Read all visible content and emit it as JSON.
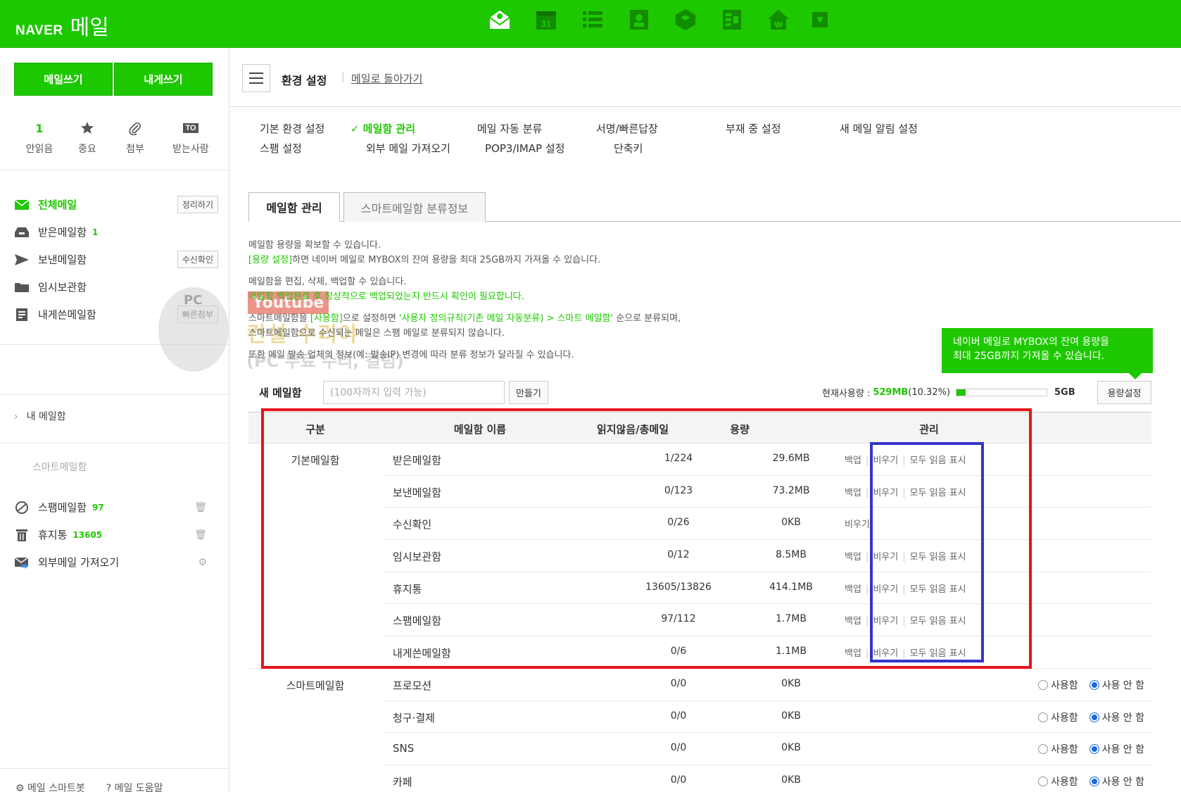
{
  "header": {
    "logo_naver": "NAVER",
    "logo_mail": "메일",
    "icons": [
      "mail-icon",
      "calendar-icon",
      "list-icon",
      "contacts-icon",
      "box-icon",
      "memo-icon",
      "home-icon",
      "more-icon"
    ],
    "calendar_day": "31",
    "brand_color": "#1ec800"
  },
  "sidebar": {
    "write_mail": "메일쓰기",
    "write_self": "내게쓰기",
    "quick": {
      "unread_count": "1",
      "unread_label": "안읽음",
      "important_label": "중요",
      "attach_label": "첨부",
      "to_badge": "TO",
      "recipient_label": "받는사람"
    },
    "folders": [
      {
        "label": "전체메일",
        "count": "",
        "button": "정리하기"
      },
      {
        "label": "받은메일함",
        "count": "1",
        "button": ""
      },
      {
        "label": "보낸메일함",
        "count": "",
        "button": "수신확인"
      },
      {
        "label": "임시보관함",
        "count": "",
        "button": ""
      },
      {
        "label": "내게쓴메일함",
        "count": "",
        "button": "빠른첨부"
      }
    ],
    "my_mailbox": "내 메일함",
    "smart_mailbox": "스마트메일함",
    "folders2": [
      {
        "label": "스팸메일함",
        "count": "97"
      },
      {
        "label": "휴지통",
        "count": "13605"
      },
      {
        "label": "외부메일 가져오기",
        "count": ""
      }
    ],
    "bottom_left": "메일 스마트봇",
    "bottom_right": "메일 도움말"
  },
  "watermark": {
    "badge": "PC",
    "youtube": "Youtube",
    "text": "컨설 수리야",
    "sub": "(PC 무료 수리, 컬럼)"
  },
  "main": {
    "title": "환경 설정",
    "separator": "|",
    "back_link": "메일로 돌아가기",
    "nav": [
      {
        "label": "기본 환경 설정",
        "active": false
      },
      {
        "label": "메일함 관리",
        "active": true
      },
      {
        "label": "메일 자동 분류",
        "active": false
      },
      {
        "label": "서명/빠른답장",
        "active": false
      },
      {
        "label": "부재 중 설정",
        "active": false
      },
      {
        "label": "새 메일 알림 설정",
        "active": false
      },
      {
        "label": "스팸 설정",
        "active": false
      },
      {
        "label": "외부 메일 가져오기",
        "active": false
      },
      {
        "label": "POP3/IMAP 설정",
        "active": false
      },
      {
        "label": "단축키",
        "active": false
      }
    ],
    "tabs": [
      "메일함 관리",
      "스마트메일함 분류정보"
    ],
    "desc": {
      "l1": "메일함 용량을 확보할 수 있습니다.",
      "l2_green": "[용량 설정]",
      "l2_rest": "하면 네이버 메일로 MYBOX의 잔여 용량을 최대 25GB까지 가져올 수 있습니다.",
      "l3": "메일함을 편집, 삭제, 백업할 수 있습니다.",
      "l4_green": "메일함 백업완료 후 정상적으로 백업되었는지 반드시 확인이 필요합니다.",
      "l5_a": "스마트메일함을 ",
      "l5_green1": "[사용함]",
      "l5_b": "으로 설정하면 ",
      "l5_green2": "'사용자 정의규칙(기존 메일 자동분류) > 스마트 메일함'",
      "l5_c": " 순으로 분류되며,",
      "l6": "스마트메일함으로 수신되는 메일은 스팸 메일로 분류되지 않습니다.",
      "l7": "또한 메일 발송 업체의 정보(예: 발송IP) 변경에 따라 분류 정보가 달라질 수 있습니다."
    },
    "tooltip_l1": "네이버 메일로 MYBOX의 잔여 용량을",
    "tooltip_l2": "최대 25GB까지 가져올 수 있습니다.",
    "new_box": {
      "label": "새 메일함",
      "placeholder": "(100자까지 입력 가능)",
      "button": "만들기"
    },
    "usage": {
      "label": "현재사용량 :",
      "value": "529MB",
      "percent_text": "(10.32%)",
      "percent": 10.32,
      "max": "5GB",
      "button": "용량설정"
    },
    "table": {
      "headers": [
        "구분",
        "메일함 이름",
        "읽지않음/총메일",
        "용량",
        "관리"
      ],
      "backup": "백업",
      "empty": "비우기",
      "mark_read": "모두 읽음 표시",
      "use_on": "사용함",
      "use_off": "사용 안 함",
      "group_basic": "기본메일함",
      "group_smart": "스마트메일함",
      "rows": [
        {
          "name": "받은메일함",
          "count": "1/224",
          "size": "29.6MB"
        },
        {
          "name": "보낸메일함",
          "count": "0/123",
          "size": "73.2MB"
        },
        {
          "name": "수신확인",
          "count": "0/26",
          "size": "0KB"
        },
        {
          "name": "임시보관함",
          "count": "0/12",
          "size": "8.5MB"
        },
        {
          "name": "휴지통",
          "count": "13605/13826",
          "size": "414.1MB"
        },
        {
          "name": "스팸메일함",
          "count": "97/112",
          "size": "1.7MB"
        },
        {
          "name": "내게쓴메일함",
          "count": "0/6",
          "size": "1.1MB"
        }
      ],
      "smart_rows": [
        {
          "name": "프로모션",
          "count": "0/0",
          "size": "0KB"
        },
        {
          "name": "청구·결제",
          "count": "0/0",
          "size": "0KB"
        },
        {
          "name": "SNS",
          "count": "0/0",
          "size": "0KB"
        },
        {
          "name": "카페",
          "count": "0/0",
          "size": "0KB"
        }
      ]
    },
    "highlight_colors": {
      "red": "#e8141c",
      "blue": "#3535c9"
    }
  }
}
